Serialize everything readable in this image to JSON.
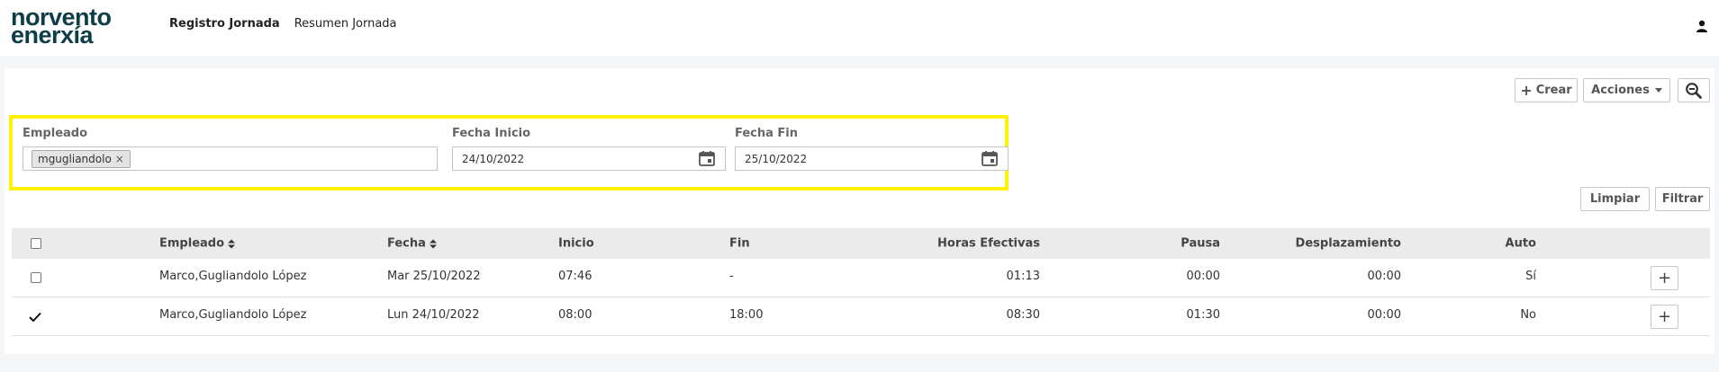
{
  "header": {
    "logo_line1": "norvento",
    "logo_line2": "enerxía",
    "nav": [
      {
        "label": "Registro Jornada",
        "active": true
      },
      {
        "label": "Resumen Jornada",
        "active": false
      }
    ]
  },
  "toolbar": {
    "create_label": "Crear",
    "actions_label": "Acciones",
    "clear_label": "Limpiar",
    "filter_label": "Filtrar"
  },
  "filters": {
    "employee_label": "Empleado",
    "employee_tag": "mgugliandolo",
    "employee_tag_remove": "×",
    "start_label": "Fecha Inicio",
    "start_value": "24/10/2022",
    "end_label": "Fecha Fin",
    "end_value": "25/10/2022"
  },
  "table": {
    "headers": {
      "empleado": "Empleado",
      "fecha": "Fecha",
      "inicio": "Inicio",
      "fin": "Fin",
      "horas": "Horas Efectivas",
      "pausa": "Pausa",
      "desplazamiento": "Desplazamiento",
      "auto": "Auto"
    },
    "rows": [
      {
        "selected": false,
        "empleado": "Marco,Gugliandolo López",
        "fecha": "Mar 25/10/2022",
        "inicio": "07:46",
        "fin": "-",
        "horas": "01:13",
        "pausa": "00:00",
        "desplazamiento": "00:00",
        "auto": "Sí"
      },
      {
        "selected": true,
        "empleado": "Marco,Gugliandolo López",
        "fecha": "Lun 24/10/2022",
        "inicio": "08:00",
        "fin": "18:00",
        "horas": "08:30",
        "pausa": "01:30",
        "desplazamiento": "00:00",
        "auto": "No"
      }
    ]
  },
  "colors": {
    "brand": "#0c3d49",
    "highlight": "#fff200",
    "table_header_bg": "#ebebeb"
  }
}
